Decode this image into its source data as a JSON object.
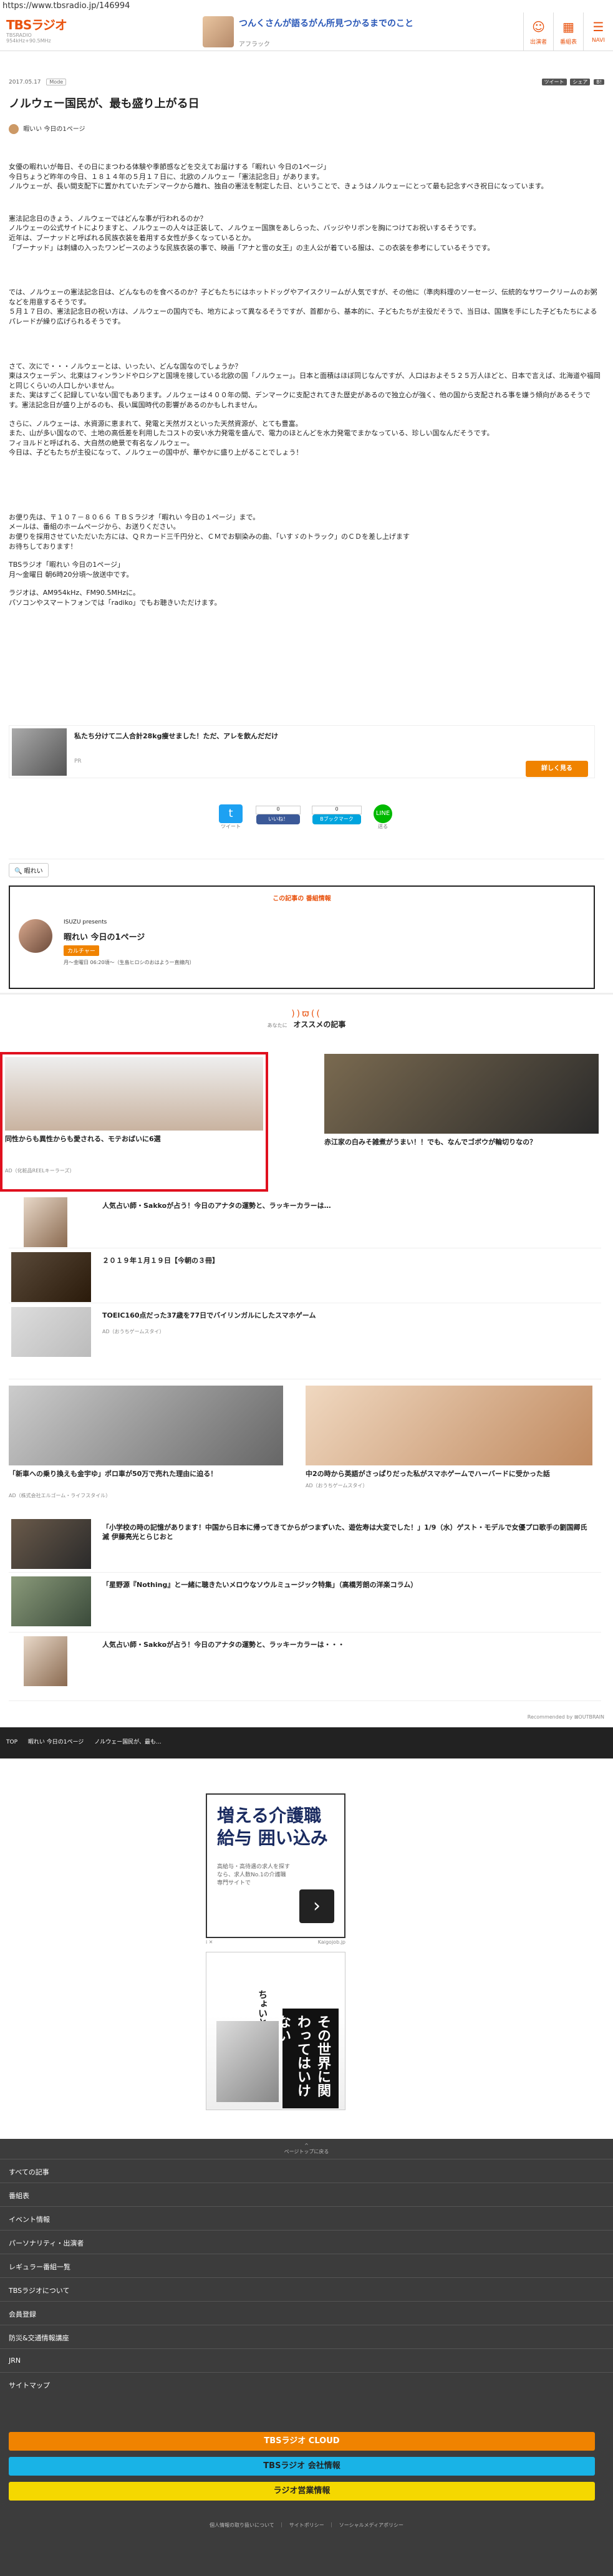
{
  "url": "https://www.tbsradio.jp/146994",
  "header": {
    "logo": "TBSラジオ",
    "logo_sub": "TBSRADIO 954kHz+90.5MHz",
    "ad_title": "つんくさんが語るがん所見つかるまでのこと",
    "ad_sponsor": "アフラック",
    "buttons": [
      {
        "label": "出演者",
        "icon": "person-icon"
      },
      {
        "label": "番組表",
        "icon": "calendar-icon"
      },
      {
        "label": "NAVI",
        "icon": "menu-icon"
      }
    ]
  },
  "article": {
    "date": "2017.05.17",
    "tag": "Mode",
    "share_counts": [
      "ツイート",
      "シェア",
      "B!"
    ],
    "title": "ノルウェー国民が、最も盛り上がる日",
    "program": "暇いい 今日の1ページ",
    "paragraphs": [
      "女優の暇れいが毎日、その日にまつわる体験や季節感などを交えてお届けする「暇れい 今日の1ページ」\n今日ちょうど昨年の今日、１８１４年の５月１７日に、北欧のノルウェー「憲法記念日」があります。\nノルウェーが、長い間支配下に置かれていたデンマークから離れ、独自の憲法を制定した日、ということで、きょうはノルウェーにとって最も記念すべき祝日になっています。",
      "憲法記念日のきょう、ノルウェーではどんな事が行われるのか？\nノルウェーの公式サイトによりますと、ノルウェーの人々は正装して、ノルウェー国旗をあしらった、バッジやリボンを胸につけてお祝いするそうです。\n近年は、ブーナッドと呼ばれる民族衣装を着用する女性が多くなっているとか。\n「ブーナッド」は刺繍の入ったワンピースのような民族衣装の事で、映画「アナと雪の女王」の主人公が着ている服は、この衣装を参考にしているそうです。",
      "では、ノルウェーの憲法記念日は、どんなものを食べるのか？子どもたちにはホットドッグやアイスクリームが人気ですが、その他に（準肉料理のソーセージ、伝統的なサワークリームのお粥などを用意するそうです。\n５月１７日の、憲法記念日の祝い方は、ノルウェーの国内でも、地方によって異なるそうですが、首都から、基本的に、子どもたちが主役だそうで、当日は、国旗を手にした子どもたちによるパレードが繰り広げられるそうです。",
      "さて、次にで・・・ノルウェーとは、いったい、どんな国なのでしょうか？\n東はスウェーデン、北東はフィンランドやロシアと国境を接している北欧の国「ノルウェー」。日本と面積はほぼ同じなんですが、人口はおよそ５２５万人ほどと、日本で言えば、北海道や福岡と同じくらいの人口しかいません。\nまた、実はすごく記録していない国でもあります。ノルウェーは４００年の間、デンマークに支配されてきた歴史があるので独立心が強く、他の国から支配される事を嫌う傾向があるそうです。憲法記念日が盛り上がるのも、長い属国時代の影響があるのかもしれません。",
      "さらに、ノルウェーは、水資源に恵まれて、発電と天然ガスといった天然資源が、とても豊富。\nまた、山が多い国なので、土地の高低差を利用したコストの安い水力発電を盛んで、電力のほとんどを水力発電でまかなっている、珍しい国なんだそうです。\nフィヨルドと呼ばれる、大自然の絶景で有名なノルウェー。\n今日は、子どもたちが主役になって、ノルウェーの国中が、華やかに盛り上がることでしょう！",
      "",
      "お便り先は、〒１０７－８０６６ ＴＢＳラジオ「暇れい 今日の１ページ」まで。\nメールは、番組のホームページから、お送りください。\nお便りを採用させていただいた方には、ＱＲカード三千円分と、ＣＭでお馴染みの曲、「いすゞのトラック」のＣＤを差し上げます\nお待ちしております！",
      "TBSラジオ「暇れい 今日の1ページ」\n月～金曜日 朝6時20分頃～放送中です。",
      "ラジオは、AM954kHz、FM90.5MHzに。\nパソコンやスマートフォンでは「radiko」でもお聴きいただけます。"
    ],
    "radiko": "radiko"
  },
  "banner": {
    "text": "私たち分けて二人合計28kg痩せました！ただ、アレを飲んだだけ",
    "sponsor": "PR",
    "button": "詳しく見る"
  },
  "share": [
    {
      "label": "ツイート",
      "count": "",
      "icon": "twitter-icon",
      "color": "#1da1f2"
    },
    {
      "label": "いいね！",
      "count": "0",
      "icon": "facebook-icon",
      "color": "#3b5998"
    },
    {
      "label": "Bブックマーク",
      "count": "0",
      "icon": "hatena-icon",
      "color": "#00a4de"
    },
    {
      "label": "送る",
      "count": "",
      "icon": "line-icon",
      "color": "#00b900"
    }
  ],
  "tags": [
    "暇れい"
  ],
  "program_box": {
    "header_pre": "この記事の",
    "header": "番組情報",
    "presenter": "ISUZU presents",
    "title": "暇れい 今日の1ページ",
    "badge": "カルチャー",
    "schedule": "月～金曜日 06:20頃～（生島ヒロシのおはよう一直線内）"
  },
  "recommend": {
    "pre": "あなたに",
    "title": "オススメの記事",
    "featured": [
      {
        "title": "同性からも異性からも愛される、モテおばいに6選",
        "source": "AD（化粧品REELキーラーズ）"
      },
      {
        "title": "赤江家の白みそ雑煮がうまい！！でも、なんでゴボウが輪切りなの？",
        "source": ""
      }
    ],
    "rows": [
      {
        "title": "人気占い師・Sakkoが占う！今日のアナタの運勢と、ラッキーカラーは…",
        "source": ""
      },
      {
        "title": "２０１９年１月１９日【今朝の３冊】",
        "source": ""
      },
      {
        "title": "TOEIC160点だった37歳を77日でバイリンガルにしたスマホゲーム",
        "source": "AD（おうちゲームスタイ）"
      }
    ],
    "pair": [
      {
        "title": "「新車への乗り換えも金宇ゆ」ポロ車が50万で売れた理由に迫る！",
        "source": "AD（株式会社エルゴーム・ライフスタイル）"
      },
      {
        "title": "中2の時から英語がさっぱりだった私がスマホゲームでハーバードに受かった話",
        "source": "AD（おうちゲームスタイ）"
      }
    ],
    "rows2": [
      {
        "title": "「小学校の時の記憶があります！中国から日本に帰ってきてからがつまずいた、遊佐寿は大変でした！」1/9（水）ゲスト・モデルで女優プロ歌手の劉国卿氏滅 伊藤亮光とらじおと",
        "source": ""
      },
      {
        "title": "「星野源『Nothing』と一緒に聴きたいメロウなソウルミュージック特集」（高橋芳朗の洋楽コラム）",
        "source": ""
      },
      {
        "title": "人気占い師・Sakkoが占う！今日のアナタの運勢と、ラッキーカラーは・・・",
        "source": ""
      }
    ],
    "powered": "Recommended by ⊠OUTBRAIN"
  },
  "breadcrumb": [
    "TOP",
    "暇れい 今日の1ページ",
    "ノルウェー国民が、最も..."
  ],
  "ad_care": {
    "headline": "増える介護職\n給与 囲い込み",
    "body": "高給与・高待遇の求人を探すなら、求人数No.1の介護職専門サイトで",
    "label": "i ✕",
    "source": "Kaigojob.jp"
  },
  "ad_manga": {
    "t1": "ちょいと",
    "t2": "その世界に関わってはいけない"
  },
  "footer": {
    "pagetop": "ページトップに戻る",
    "items": [
      "すべての記事",
      "番組表",
      "イベント情報",
      "パーソナリティ・出演者",
      "レギュラー番組一覧",
      "TBSラジオについて",
      "会員登録",
      "防災&交通情報講座",
      "JRN",
      "サイトマップ"
    ],
    "buttons": [
      {
        "label": "TBSラジオ CLOUD",
        "color": "#f08300"
      },
      {
        "label": "TBSラジオ 会社情報",
        "color": "#19b3e6"
      },
      {
        "label": "ラジオ営業情報",
        "color": "#f5d800"
      }
    ],
    "legal": "個人情報の取り扱いについて　｜　サイトポリシー　｜　ソーシャルメディアポリシー"
  }
}
